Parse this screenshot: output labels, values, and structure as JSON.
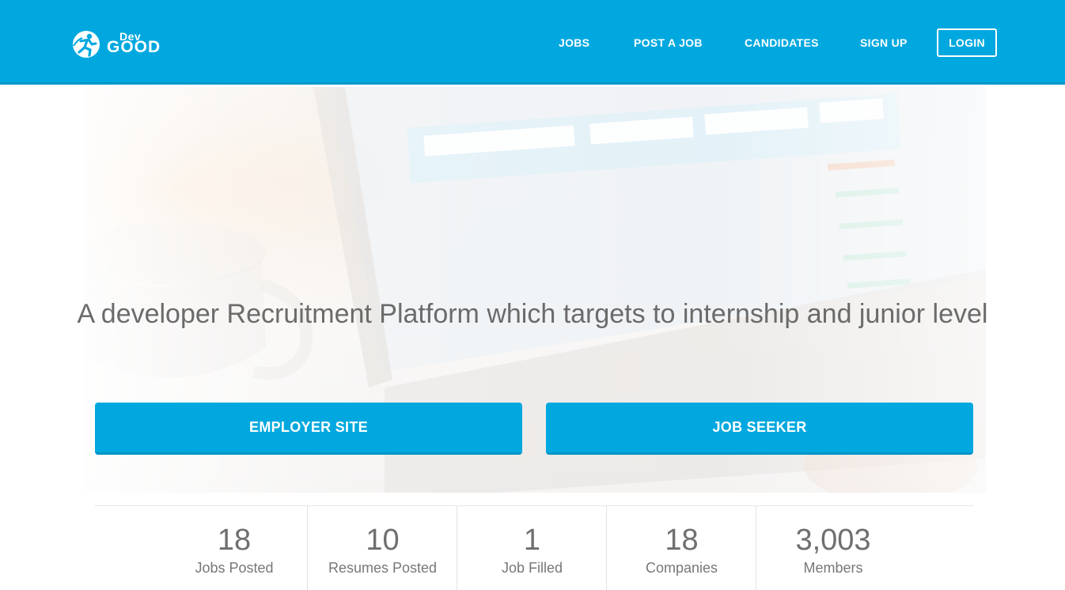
{
  "brand": {
    "logo_top": "Dev",
    "logo_bottom": "GOOD"
  },
  "nav": {
    "jobs": "JOBS",
    "post_a_job": "POST A JOB",
    "candidates": "CANDIDATES",
    "sign_up": "SIGN UP",
    "login": "LOGIN"
  },
  "hero": {
    "title": "A developer Recruitment Platform which targets to internship and junior level",
    "employer_button": "EMPLOYER SITE",
    "seeker_button": "JOB SEEKER"
  },
  "stats": [
    {
      "value": "18",
      "label": "Jobs Posted"
    },
    {
      "value": "10",
      "label": "Resumes Posted"
    },
    {
      "value": "1",
      "label": "Job Filled"
    },
    {
      "value": "18",
      "label": "Companies"
    },
    {
      "value": "3,003",
      "label": "Members"
    }
  ],
  "colors": {
    "primary": "#00a8df",
    "text_gray": "#6b6b6b"
  },
  "icons": {
    "logo": "runner-logo-icon"
  }
}
